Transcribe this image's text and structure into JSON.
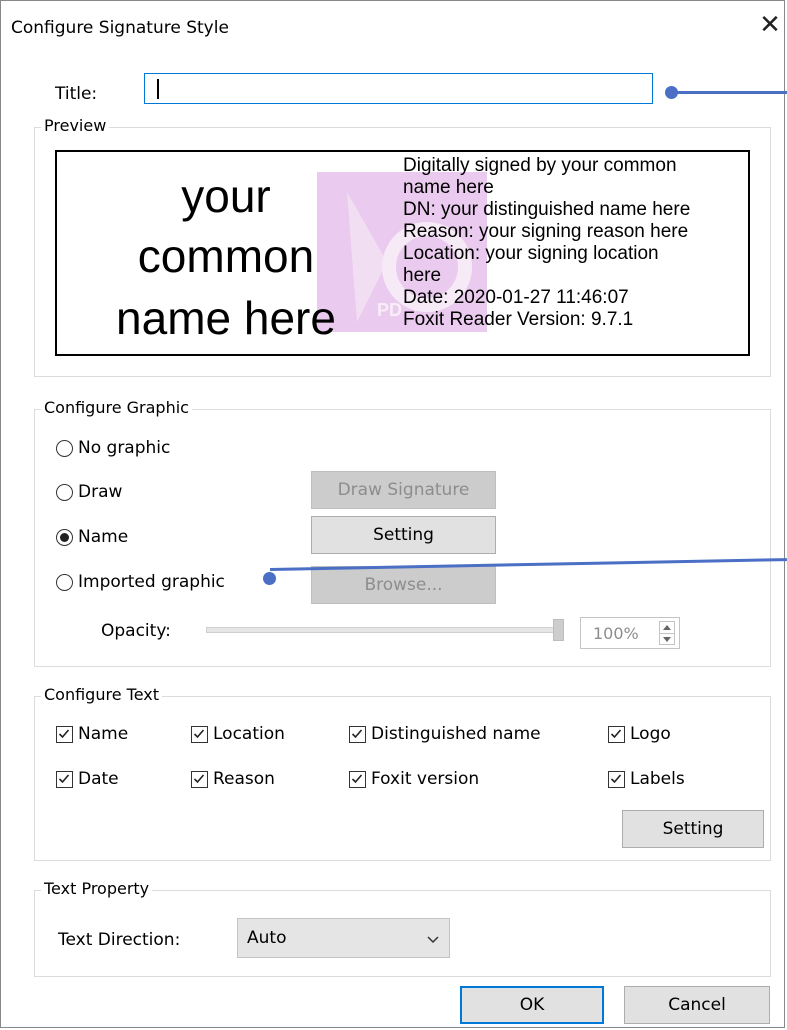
{
  "window": {
    "title": "Configure Signature Style",
    "close_glyph": "✕"
  },
  "title_field": {
    "label": "Title:",
    "value": "",
    "placeholder": ""
  },
  "preview": {
    "legend": "Preview",
    "common_name_lines": [
      "your",
      "common",
      "name here"
    ],
    "info_lines": [
      "Digitally signed by your common",
      "name here",
      "DN: your distinguished name here",
      "Reason: your signing reason here",
      "Location: your signing location",
      "here",
      "Date: 2020-01-27 11:46:07",
      "Foxit Reader Version: 9.7.1"
    ],
    "watermark_text": "PD"
  },
  "graphic": {
    "legend": "Configure Graphic",
    "options": [
      {
        "label": "No graphic",
        "selected": false
      },
      {
        "label": "Draw",
        "selected": false
      },
      {
        "label": "Name",
        "selected": true
      },
      {
        "label": "Imported graphic",
        "selected": false
      }
    ],
    "draw_signature_button": "Draw Signature",
    "setting_button": "Setting",
    "browse_button": "Browse...",
    "opacity_label": "Opacity:",
    "opacity_value": "100%",
    "opacity_fraction": 1.0
  },
  "text_config": {
    "legend": "Configure Text",
    "checkboxes": [
      {
        "label": "Name",
        "checked": true
      },
      {
        "label": "Location",
        "checked": true
      },
      {
        "label": "Distinguished name",
        "checked": true
      },
      {
        "label": "Logo",
        "checked": true
      },
      {
        "label": "Date",
        "checked": true
      },
      {
        "label": "Reason",
        "checked": true
      },
      {
        "label": "Foxit version",
        "checked": true
      },
      {
        "label": "Labels",
        "checked": true
      }
    ],
    "setting_button": "Setting"
  },
  "text_property": {
    "legend": "Text Property",
    "direction_label": "Text Direction:",
    "direction_value": "Auto"
  },
  "footer": {
    "ok_button": "OK",
    "cancel_button": "Cancel"
  },
  "colors": {
    "accent": "#0078d7",
    "callout": "#4a6fc4",
    "watermark": "#e6bdea"
  }
}
